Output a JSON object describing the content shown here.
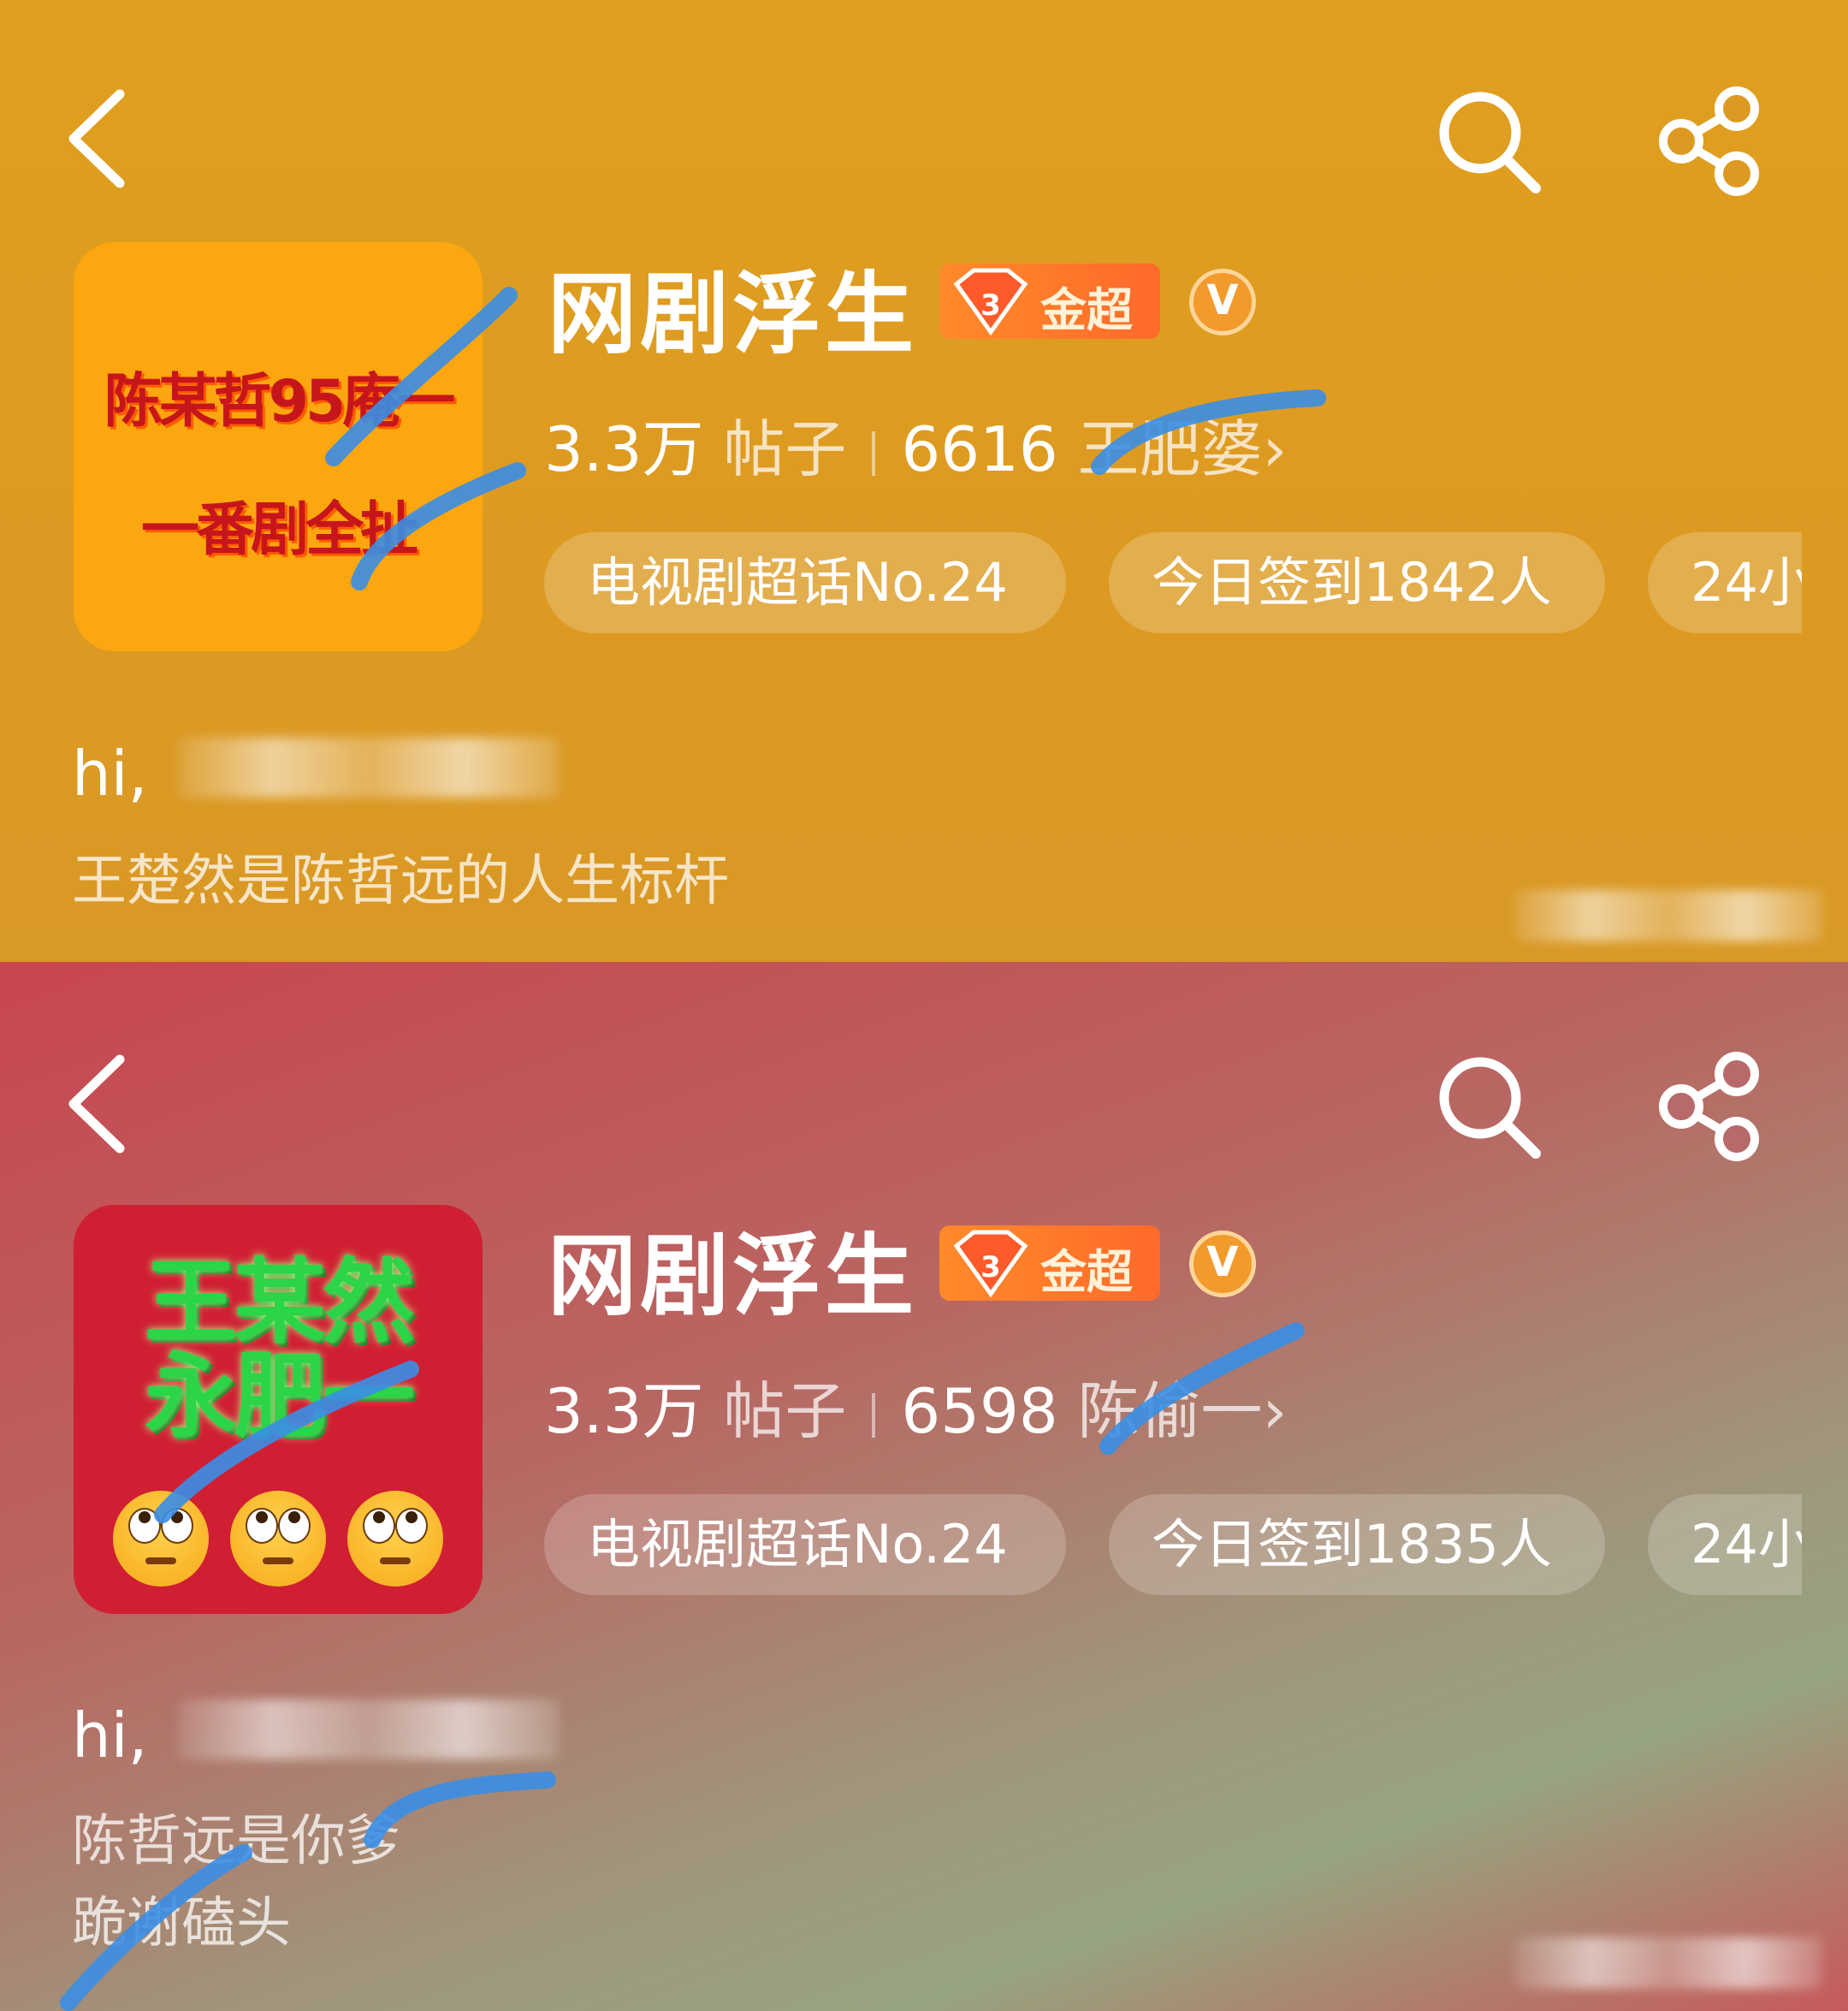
{
  "panels": [
    {
      "avatar_text": [
        "陈某哲95庵一",
        "一番剧全扯"
      ],
      "title": "网剧浮生",
      "badge": "金超",
      "v_badge": "V",
      "posts_count": "3.3万",
      "posts_label": "帖子",
      "fans_count": "6616",
      "fans_label": "王肥婆",
      "chevron": "›",
      "chips": [
        "电视剧超话No.24",
        "今日签到1842人",
        "24小"
      ],
      "greeting": "hi,",
      "description": [
        "王楚然是陈哲远的人生标杆"
      ]
    },
    {
      "avatar_text": [
        "王某然",
        "永肥一"
      ],
      "title": "网剧浮生",
      "badge": "金超",
      "v_badge": "V",
      "posts_count": "3.3万",
      "posts_label": "帖子",
      "fans_count": "6598",
      "fans_label": "陈偷一",
      "chevron": "›",
      "chips": [
        "电视剧超话No.24",
        "今日签到1835人",
        "24小"
      ],
      "greeting": "hi,",
      "description": [
        "陈哲远是你爹",
        "跪谢磕头"
      ]
    }
  ],
  "icons": {
    "back": "chevron-left-icon",
    "search": "search-icon",
    "share": "share-icon",
    "badge_gem": "diamond-icon",
    "emoji": "eye-roll-emoji-icon"
  },
  "colors": {
    "top_background": "#de9c21",
    "bottom_background": "#c84650",
    "scribble": "#3a8ee6",
    "badge": "#ff7a2a"
  }
}
